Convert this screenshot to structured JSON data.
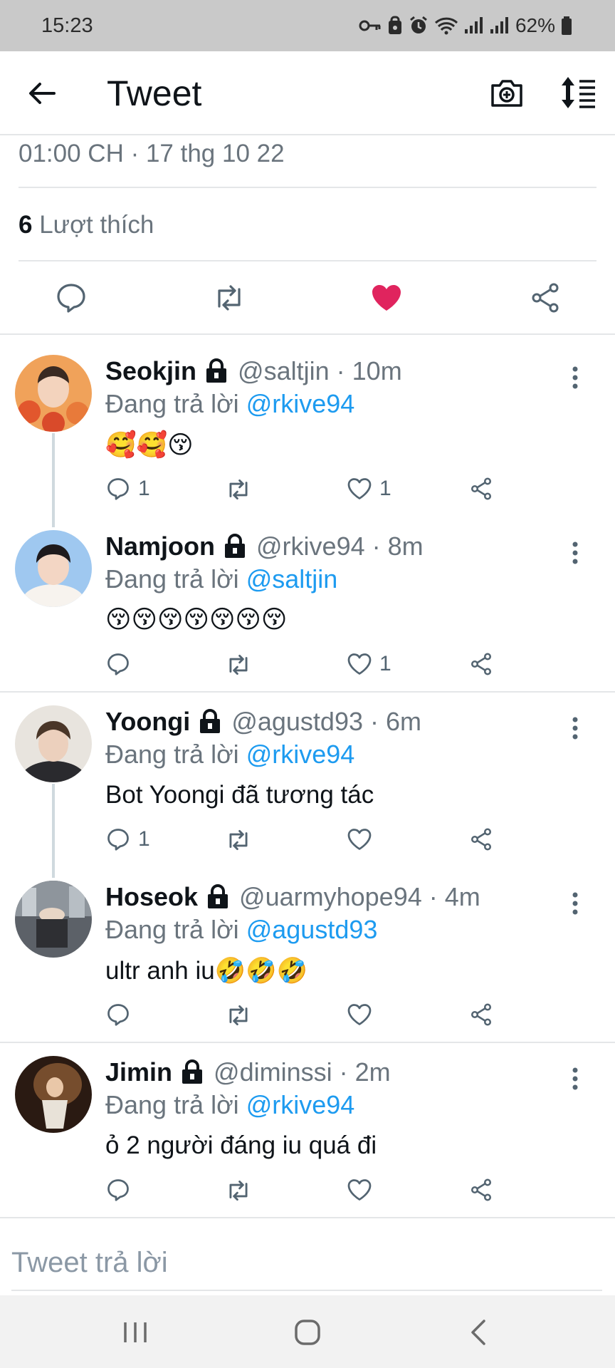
{
  "status_bar": {
    "time": "15:23",
    "battery": "62%"
  },
  "app_bar": {
    "title": "Tweet"
  },
  "tweet_meta": {
    "timestamp": "01:00 CH · 17 thg 10 22",
    "likes_count": "6",
    "likes_label": "Lượt thích"
  },
  "colors": {
    "like_red": "#e0245e",
    "mention_blue": "#1d9bf0",
    "secondary_text": "#6a747d"
  },
  "replies": [
    {
      "name": "Seokjin",
      "handle": "@saltjin",
      "time": "· 10m",
      "reply_prefix": "Đang trả lời",
      "reply_to": "@rkive94",
      "text": "🥰🥰😚",
      "reply_count": "1",
      "like_count": "1"
    },
    {
      "name": "Namjoon",
      "handle": "@rkive94",
      "time": "· 8m",
      "reply_prefix": "Đang trả lời",
      "reply_to": "@saltjin",
      "text": "😚😚😚😚😚😚😚",
      "reply_count": "",
      "like_count": "1"
    },
    {
      "name": "Yoongi",
      "handle": "@agustd93",
      "time": "· 6m",
      "reply_prefix": "Đang trả lời",
      "reply_to": "@rkive94",
      "text": "Bot Yoongi đã tương tác",
      "reply_count": "1",
      "like_count": ""
    },
    {
      "name": "Hoseok",
      "handle": "@uarmyhope94",
      "time": "· 4m",
      "reply_prefix": "Đang trả lời",
      "reply_to": "@agustd93",
      "text": "ultr anh iu🤣🤣🤣",
      "reply_count": "",
      "like_count": ""
    },
    {
      "name": "Jimin",
      "handle": "@diminssi",
      "time": "· 2m",
      "reply_prefix": "Đang trả lời",
      "reply_to": "@rkive94",
      "text": "ỏ 2 người đáng iu quá đi",
      "reply_count": "",
      "like_count": ""
    }
  ],
  "reply_box": {
    "placeholder": "Tweet trả lời"
  }
}
